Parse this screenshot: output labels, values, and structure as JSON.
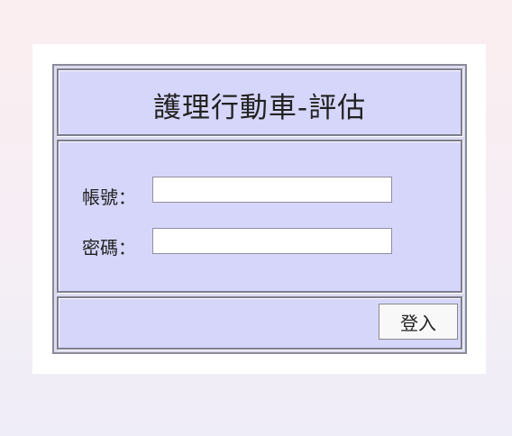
{
  "login": {
    "title": "護理行動車-評估",
    "account_label": "帳號：",
    "account_value": "",
    "password_label": "密碼：",
    "password_value": "",
    "login_button_label": "登入"
  },
  "colors": {
    "panel_background": "#d6d6fb",
    "frame_border": "#7e7e8e",
    "page_background_top": "#fbeef0",
    "page_background_bottom": "#efedf8"
  }
}
